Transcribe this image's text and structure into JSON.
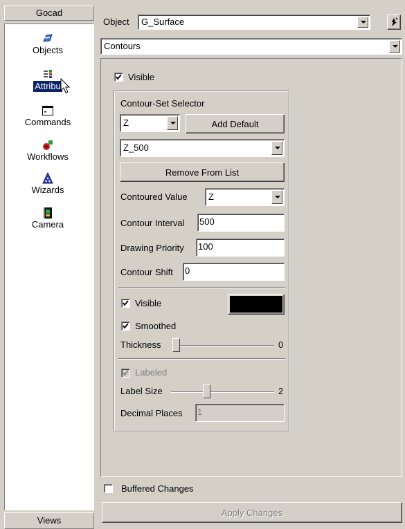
{
  "left_panel": {
    "header": "Gocad",
    "footer": "Views",
    "tools": [
      {
        "label": "Objects",
        "icon": "objects-icon",
        "selected": false
      },
      {
        "label": "Attributes",
        "display": "Attribu",
        "icon": "attributes-icon",
        "selected": true
      },
      {
        "label": "Commands",
        "icon": "commands-icon",
        "selected": false
      },
      {
        "label": "Workflows",
        "icon": "workflows-icon",
        "selected": false
      },
      {
        "label": "Wizards",
        "icon": "wizards-icon",
        "selected": false
      },
      {
        "label": "Camera",
        "icon": "camera-icon",
        "selected": false
      }
    ]
  },
  "object_row": {
    "label": "Object",
    "value": "G_Surface"
  },
  "panel_select": {
    "value": "Contours"
  },
  "contours": {
    "visible_label": "Visible",
    "visible_checked": true,
    "selector_title": "Contour-Set Selector",
    "property_select": "Z",
    "add_default_label": "Add Default",
    "contour_set_select": "Z_500",
    "remove_label": "Remove From List",
    "contoured_value_label": "Contoured Value",
    "contoured_value": "Z",
    "interval_label": "Contour Interval",
    "interval_value": "500",
    "priority_label": "Drawing Priority",
    "priority_value": "100",
    "shift_label": "Contour Shift",
    "shift_value": "0",
    "lines_visible_label": "Visible",
    "lines_visible_checked": true,
    "line_color": "#000000",
    "smoothed_label": "Smoothed",
    "smoothed_checked": true,
    "thickness_label": "Thickness",
    "thickness_value": "0",
    "labeled_label": "Labeled",
    "labeled_checked": true,
    "label_size_label": "Label Size",
    "label_size_value": "2",
    "decimal_places_label": "Decimal Places",
    "decimal_places_value": "1"
  },
  "bottom": {
    "buffered_label": "Buffered Changes",
    "buffered_checked": false,
    "apply_label": "Apply Changes"
  }
}
